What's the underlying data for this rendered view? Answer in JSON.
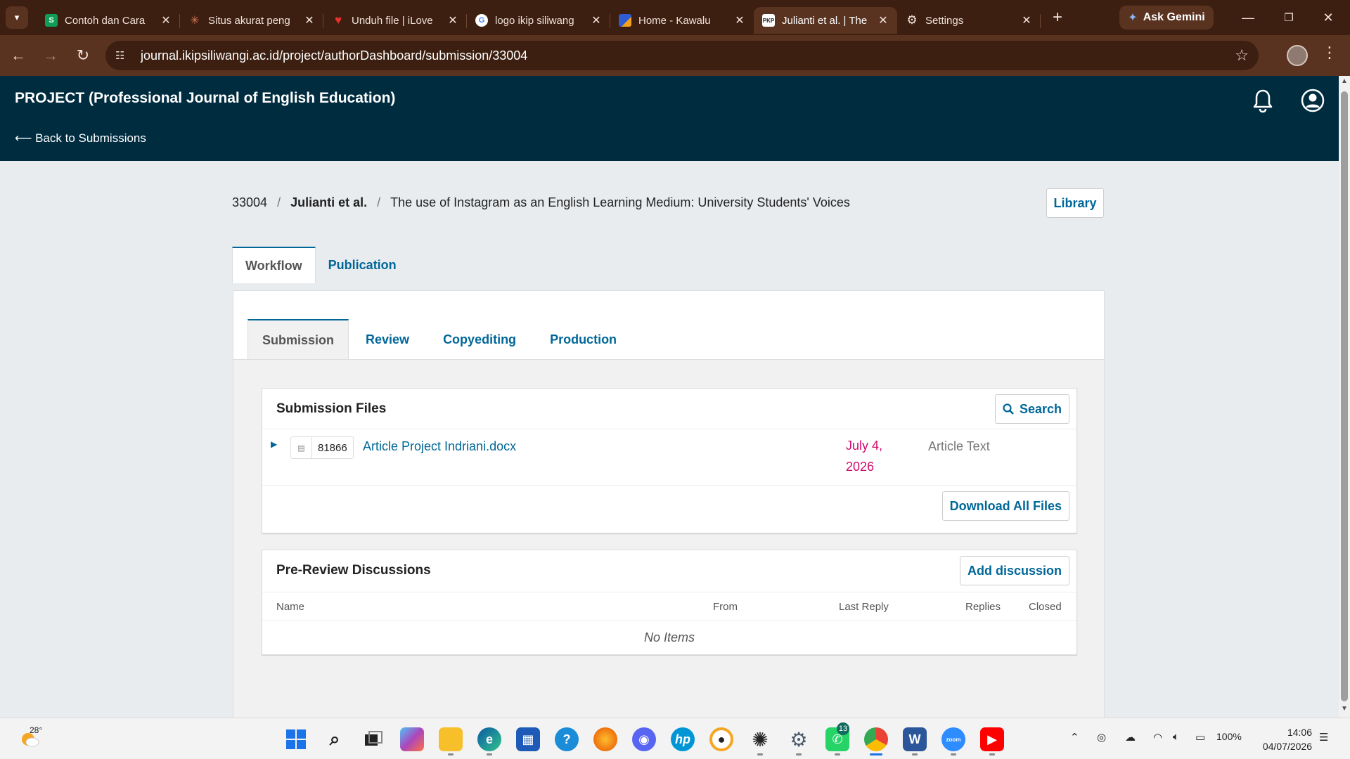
{
  "browser": {
    "tabs": [
      {
        "title": "Contoh dan Cara",
        "favicon_text": "S",
        "favicon_color": "#0f9d58"
      },
      {
        "title": "Situs akurat peng",
        "favicon_text": "✳",
        "favicon_color": "#d97757"
      },
      {
        "title": "Unduh file | iLove",
        "favicon_text": "♥",
        "favicon_color": "#e5322d"
      },
      {
        "title": "logo ikip siliwang",
        "favicon_text": "G",
        "favicon_color": "#ffffff"
      },
      {
        "title": "Home - Kawalu",
        "favicon_text": "",
        "favicon_color": "#2f5bd3"
      },
      {
        "title": "Julianti et al. | The",
        "favicon_text": "PKP",
        "favicon_color": "#ffffff"
      },
      {
        "title": "Settings",
        "favicon_text": "⚙",
        "favicon_color": "#5a3320"
      }
    ],
    "active_tab_index": 5,
    "ask_gemini": "Ask Gemini",
    "url": "journal.ikipsiliwangi.ac.id/project/authorDashboard/submission/33004"
  },
  "header": {
    "site_title": "PROJECT (Professional Journal of English Education)",
    "back_link": "⟵ Back to Submissions"
  },
  "breadcrumb": {
    "id": "33004",
    "separator": "/",
    "authors": "Julianti et al.",
    "title": "The use of Instagram as an English Learning Medium: University Students' Voices"
  },
  "library_button": "Library",
  "main_tabs": [
    "Workflow",
    "Publication"
  ],
  "sub_tabs": [
    "Submission",
    "Review",
    "Copyediting",
    "Production"
  ],
  "submission_files": {
    "title": "Submission Files",
    "search_button": "Search",
    "files": [
      {
        "id": "81866",
        "name": "Article Project Indriani.docx",
        "date": "July 4, 2026",
        "type": "Article Text"
      }
    ],
    "download_all": "Download All Files"
  },
  "discussions": {
    "title": "Pre-Review Discussions",
    "add_button": "Add discussion",
    "columns": [
      "Name",
      "From",
      "Last Reply",
      "Replies",
      "Closed"
    ],
    "empty_text": "No Items"
  },
  "taskbar": {
    "temperature": "28°",
    "whatsapp_badge": "13",
    "battery": "100%",
    "time": "14:06",
    "date": "04/07/2026"
  },
  "colors": {
    "browser_frame": "#3c1f10",
    "toolbar": "#5a3320",
    "header_bg": "#002c40",
    "link": "#006798",
    "date_pink": "#d00a6c"
  }
}
